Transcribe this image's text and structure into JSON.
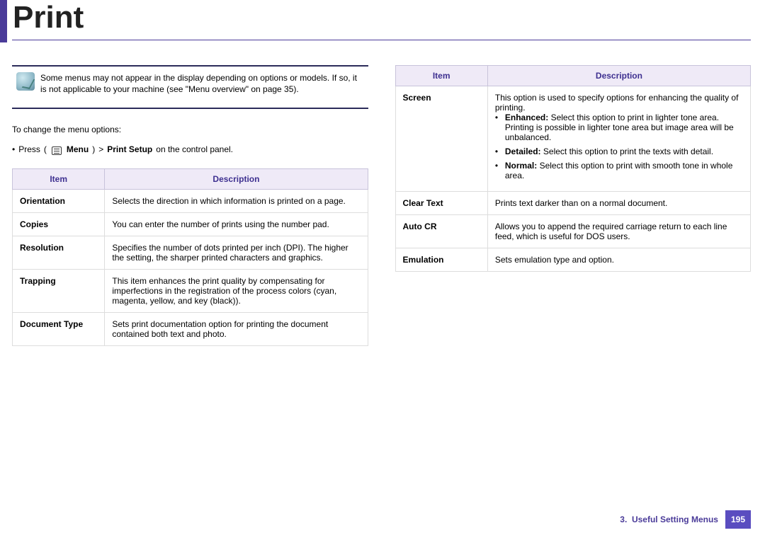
{
  "page": {
    "title": "Print",
    "section": "3.",
    "section_title": "Useful Setting Menus",
    "page_number": "195"
  },
  "note": {
    "text": "Some menus may not appear in the display depending on options or models. If so, it is not applicable to your machine (see \"Menu overview\" on page 35)."
  },
  "intro": "To change the menu options:",
  "breadcrumb": {
    "prefix": "•",
    "press": "Press",
    "menu": "Menu",
    "sep": ">",
    "target": "Print Setup",
    "suffix": "on the control panel."
  },
  "table": {
    "headers": {
      "item": "Item",
      "description": "Description"
    },
    "rows": [
      {
        "item": "Orientation",
        "desc": "Selects the direction in which information is printed on a page."
      },
      {
        "item": "Copies",
        "desc": "You can enter the number of prints using the number pad."
      },
      {
        "item": "Resolution",
        "desc": "Specifies the number of dots printed per inch (DPI). The higher the setting, the sharper printed characters and graphics."
      },
      {
        "item": "Trapping",
        "desc": "This item enhances the print quality by compensating for imperfections in the registration of the process colors (cyan, magenta, yellow, and key (black))."
      },
      {
        "item": "Document Type",
        "desc": "Sets print documentation option for printing the document contained both text and photo."
      }
    ]
  },
  "table2": {
    "rows": [
      {
        "item": "Screen",
        "desc_lead": "This option is used to specify options for enhancing the quality of printing.",
        "bullets": [
          {
            "label": "Enhanced:",
            "text": "Select this option to print in lighter tone area. Printing is possible in lighter tone area but image area will be unbalanced."
          },
          {
            "label": "Detailed:",
            "text": "Select this option to print the texts with detail."
          },
          {
            "label": "Normal:",
            "text": "Select this option to print with smooth tone in whole area."
          }
        ]
      },
      {
        "item": "Clear Text",
        "desc": "Prints text darker than on a normal document."
      },
      {
        "item": "Auto CR",
        "desc": "Allows you to append the required carriage return to each line feed, which is useful for DOS users."
      },
      {
        "item": "Emulation",
        "desc": "Sets emulation type and option."
      }
    ]
  }
}
